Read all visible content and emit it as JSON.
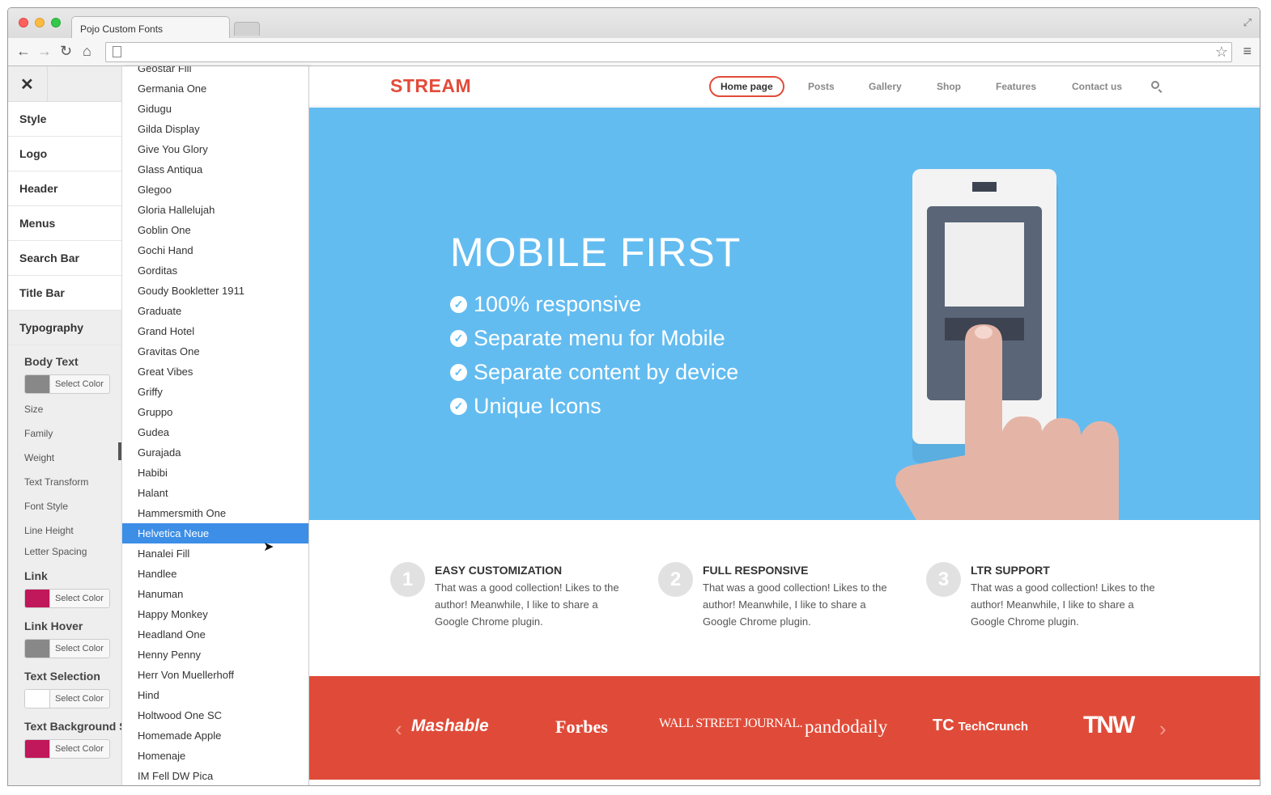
{
  "browser": {
    "tab_title": "Pojo Custom Fonts",
    "url": ""
  },
  "sidebar": {
    "close_label": "✕",
    "sections": [
      "Style",
      "Logo",
      "Header",
      "Menus",
      "Search Bar",
      "Title Bar",
      "Typography"
    ],
    "body_text": {
      "title": "Body Text",
      "color_label": "Select Color",
      "color": "#888888",
      "props": [
        "Size",
        "Family",
        "Weight",
        "Text Transform",
        "Font Style",
        "Line Height",
        "Letter Spacing"
      ]
    },
    "link": {
      "title": "Link",
      "color_label": "Select Color",
      "color": "#c0185a"
    },
    "link_hover": {
      "title": "Link Hover",
      "color_label": "Select Color",
      "color": "#888888"
    },
    "text_selection": {
      "title": "Text Selection",
      "color_label": "Select Color",
      "color": "#ffffff"
    },
    "text_background": {
      "title": "Text Background S",
      "color_label": "Select Color",
      "color": "#c0185a"
    }
  },
  "font_dropdown": {
    "selected": "Helvetica Neue",
    "items": [
      "Geostar Fill",
      "Germania One",
      "Gidugu",
      "Gilda Display",
      "Give You Glory",
      "Glass Antiqua",
      "Glegoo",
      "Gloria Hallelujah",
      "Goblin One",
      "Gochi Hand",
      "Gorditas",
      "Goudy Bookletter 1911",
      "Graduate",
      "Grand Hotel",
      "Gravitas One",
      "Great Vibes",
      "Griffy",
      "Gruppo",
      "Gudea",
      "Gurajada",
      "Habibi",
      "Halant",
      "Hammersmith One",
      "Helvetica Neue",
      "Hanalei Fill",
      "Handlee",
      "Hanuman",
      "Happy Monkey",
      "Headland One",
      "Henny Penny",
      "Herr Von Muellerhoff",
      "Hind",
      "Holtwood One SC",
      "Homemade Apple",
      "Homenaje",
      "IM Fell DW Pica"
    ]
  },
  "site": {
    "brand": "STREAM",
    "brand_color": "#e24c3a",
    "nav": [
      "Home page",
      "Posts",
      "Gallery",
      "Shop",
      "Features",
      "Contact us"
    ],
    "hero": {
      "title": "MOBILE FIRST",
      "bullets": [
        "100% responsive",
        "Separate menu for Mobile",
        "Separate content by device",
        "Unique Icons"
      ],
      "bg_color": "#63bcf0"
    },
    "features": [
      {
        "num": "1",
        "title": "EASY CUSTOMIZATION",
        "text": "That was a good collection! Likes to the author! Meanwhile, I like to share a Google Chrome plugin."
      },
      {
        "num": "2",
        "title": "FULL RESPONSIVE",
        "text": "That was a good collection! Likes to the author! Meanwhile, I like to share a Google Chrome plugin."
      },
      {
        "num": "3",
        "title": "LTR SUPPORT",
        "text": "That was a good collection! Likes to the author! Meanwhile, I like to share a Google Chrome plugin."
      }
    ],
    "press": [
      "Mashable",
      "Forbes",
      "WALL STREET JOURNAL.",
      "pandodaily",
      "TechCrunch",
      "TNW"
    ],
    "press_bg": "#e04b39"
  }
}
